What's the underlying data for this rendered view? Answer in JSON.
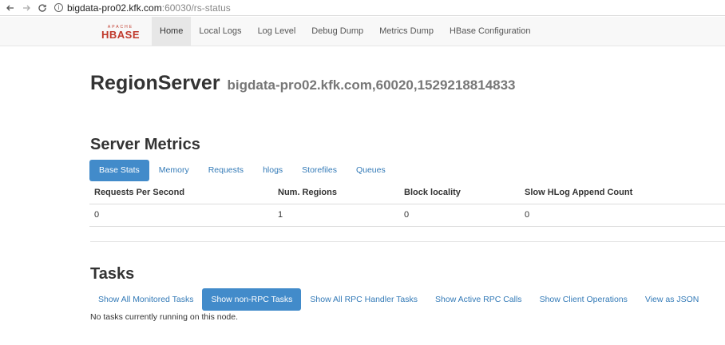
{
  "browser": {
    "url_host": "bigdata-pro02.kfk.com",
    "url_rest": ":60030/rs-status"
  },
  "navbar": {
    "logo_top": "APACHE",
    "logo_main": "HBASE",
    "items": [
      {
        "label": "Home"
      },
      {
        "label": "Local Logs"
      },
      {
        "label": "Log Level"
      },
      {
        "label": "Debug Dump"
      },
      {
        "label": "Metrics Dump"
      },
      {
        "label": "HBase Configuration"
      }
    ]
  },
  "page": {
    "title": "RegionServer",
    "subtitle": "bigdata-pro02.kfk.com,60020,1529218814833"
  },
  "server_metrics": {
    "title": "Server Metrics",
    "tabs": [
      {
        "label": "Base Stats"
      },
      {
        "label": "Memory"
      },
      {
        "label": "Requests"
      },
      {
        "label": "hlogs"
      },
      {
        "label": "Storefiles"
      },
      {
        "label": "Queues"
      }
    ],
    "headers": [
      "Requests Per Second",
      "Num. Regions",
      "Block locality",
      "Slow HLog Append Count"
    ],
    "row": [
      "0",
      "1",
      "0",
      "0"
    ]
  },
  "tasks": {
    "title": "Tasks",
    "tabs": [
      {
        "label": "Show All Monitored Tasks"
      },
      {
        "label": "Show non-RPC Tasks"
      },
      {
        "label": "Show All RPC Handler Tasks"
      },
      {
        "label": "Show Active RPC Calls"
      },
      {
        "label": "Show Client Operations"
      },
      {
        "label": "View as JSON"
      }
    ],
    "empty_message": "No tasks currently running on this node."
  },
  "colors": {
    "accent": "#428bca",
    "link": "#337ab7",
    "logo_red": "#c0392b"
  }
}
